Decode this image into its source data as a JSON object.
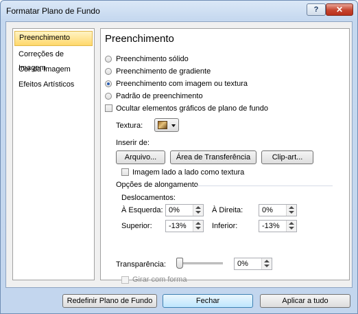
{
  "window": {
    "title": "Formatar Plano de Fundo",
    "help_glyph": "?",
    "close_glyph": "✕"
  },
  "sidebar": {
    "items": [
      {
        "label": "Preenchimento",
        "selected": true
      },
      {
        "label": "Correções de Imagem",
        "selected": false
      },
      {
        "label": "Cor da Imagem",
        "selected": false
      },
      {
        "label": "Efeitos Artísticos",
        "selected": false
      }
    ]
  },
  "panel": {
    "title": "Preenchimento",
    "options": [
      {
        "label": "Preenchimento sólido",
        "checked": false
      },
      {
        "label": "Preenchimento de gradiente",
        "checked": false
      },
      {
        "label": "Preenchimento com imagem ou textura",
        "checked": true
      },
      {
        "label": "Padrão de preenchimento",
        "checked": false
      }
    ],
    "hide_graphics_label": "Ocultar elementos gráficos de plano de fundo",
    "texture_label": "Textura:",
    "insert_from_label": "Inserir de:",
    "file_button": "Arquivo...",
    "clipboard_button": "Área de Transferência",
    "clipart_button": "Clip-art...",
    "tile_label": "Imagem lado a lado como textura",
    "stretch_label": "Opções de alongamento",
    "offsets_label": "Deslocamentos:",
    "left_label": "À Esquerda:",
    "left_value": "0%",
    "right_label": "À Direita:",
    "right_value": "0%",
    "top_label": "Superior:",
    "top_value": "-13%",
    "bottom_label": "Inferior:",
    "bottom_value": "-13%",
    "transparency_label": "Transparência:",
    "transparency_value": "0%",
    "transparency_level": 0,
    "rotate_label": "Girar com forma"
  },
  "footer": {
    "reset_button": "Redefinir Plano de Fundo",
    "close_button": "Fechar",
    "apply_all_button": "Aplicar a tudo"
  }
}
